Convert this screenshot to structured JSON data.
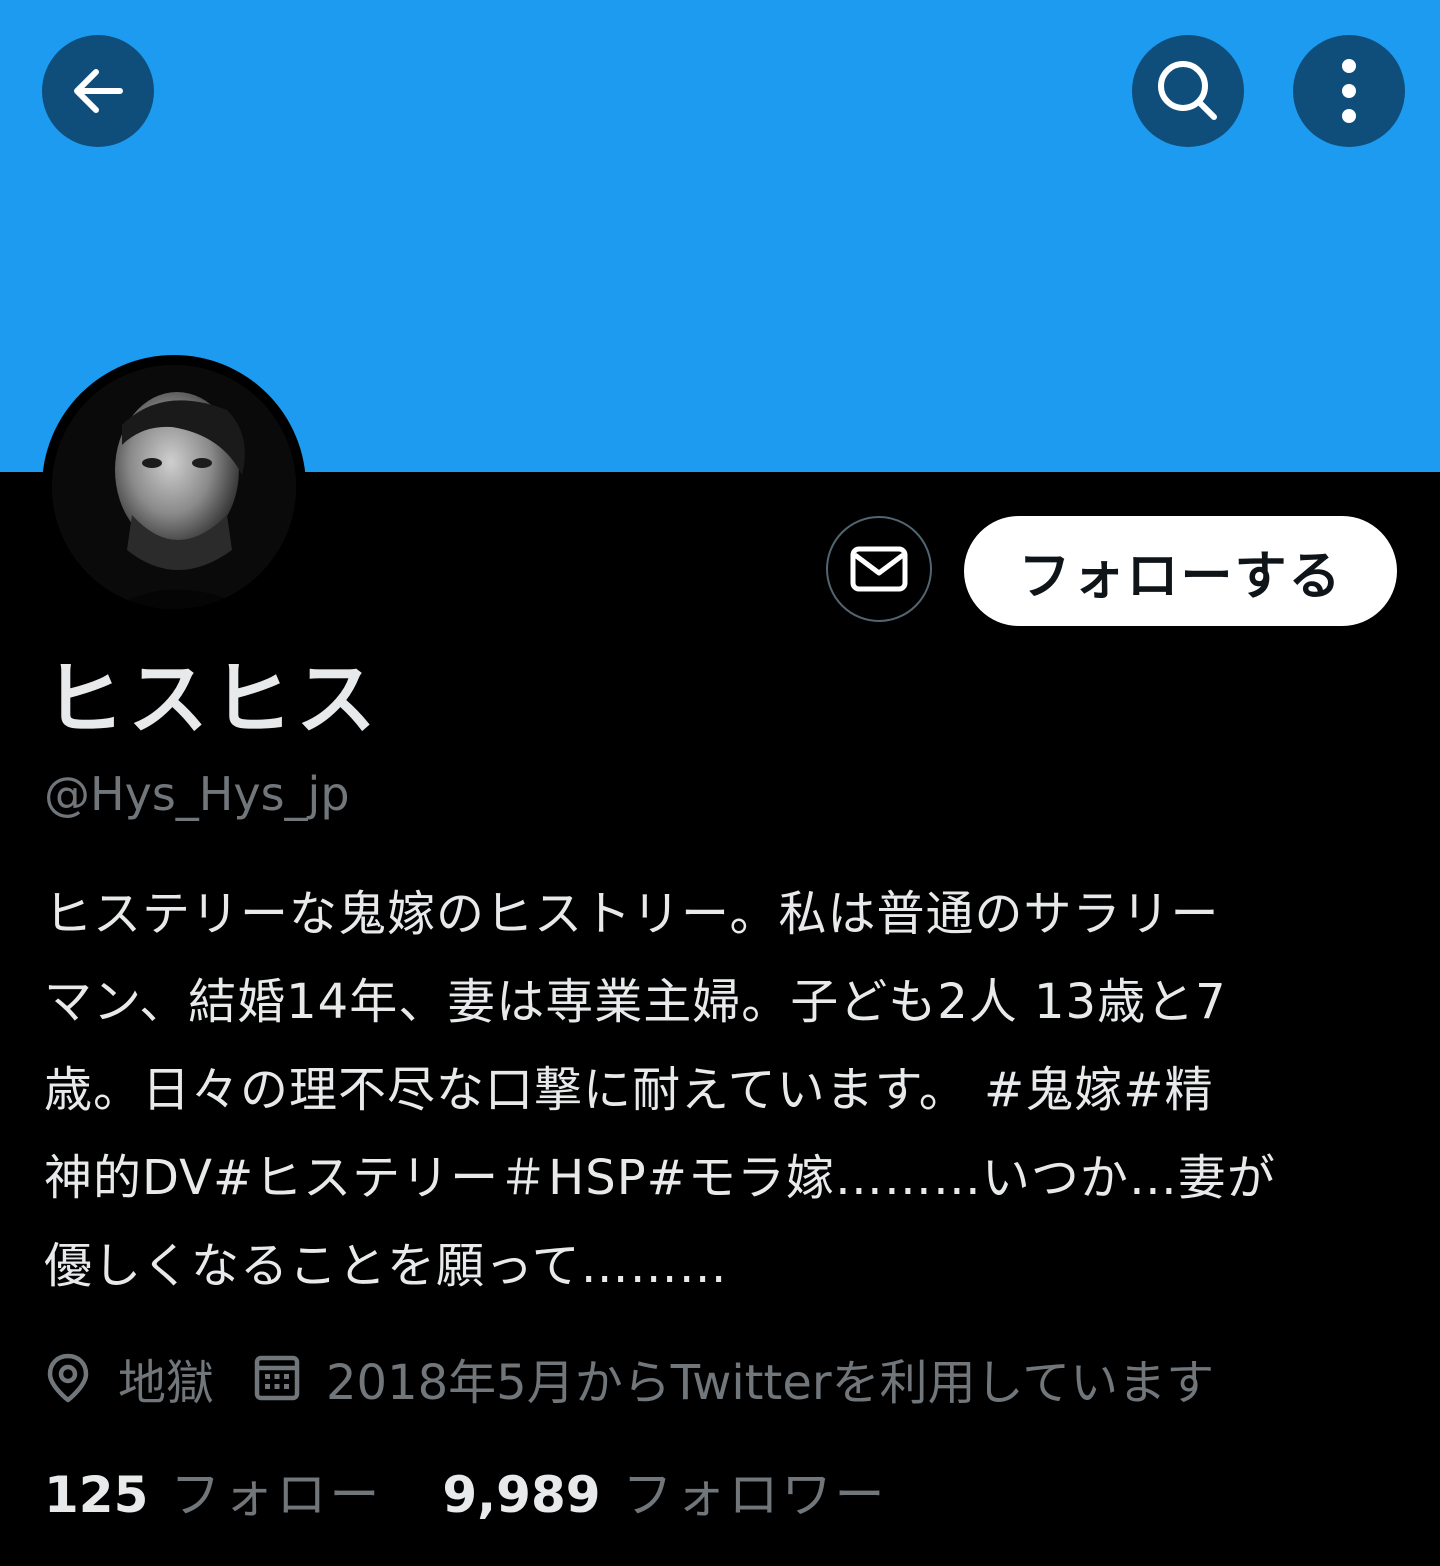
{
  "header": {
    "back_icon": "arrow-left-icon",
    "search_icon": "search-icon",
    "more_icon": "more-vertical-icon",
    "banner_color": "#1d9bf0",
    "button_bg": "#0f4e7a"
  },
  "profile": {
    "display_name": "ヒスヒス",
    "handle": "@Hys_Hys_jp",
    "bio": "ヒステリーな鬼嫁のヒストリー。私は普通のサラリー\nマン、結婚14年、妻は専業主婦。子ども2人 13歳と7\n歳。日々の理不尽な口撃に耐えています。 #鬼嫁#精\n神的DV#ヒステリー＃HSP#モラ嫁………いつか…妻が\n優しくなることを願って………",
    "location": "地獄",
    "joined": "2018年5月からTwitterを利用しています"
  },
  "actions": {
    "message_icon": "envelope-icon",
    "follow_label": "フォローする"
  },
  "stats": {
    "following_count": "125",
    "following_label": "フォロー",
    "followers_count": "9,989",
    "followers_label": "フォロワー"
  }
}
